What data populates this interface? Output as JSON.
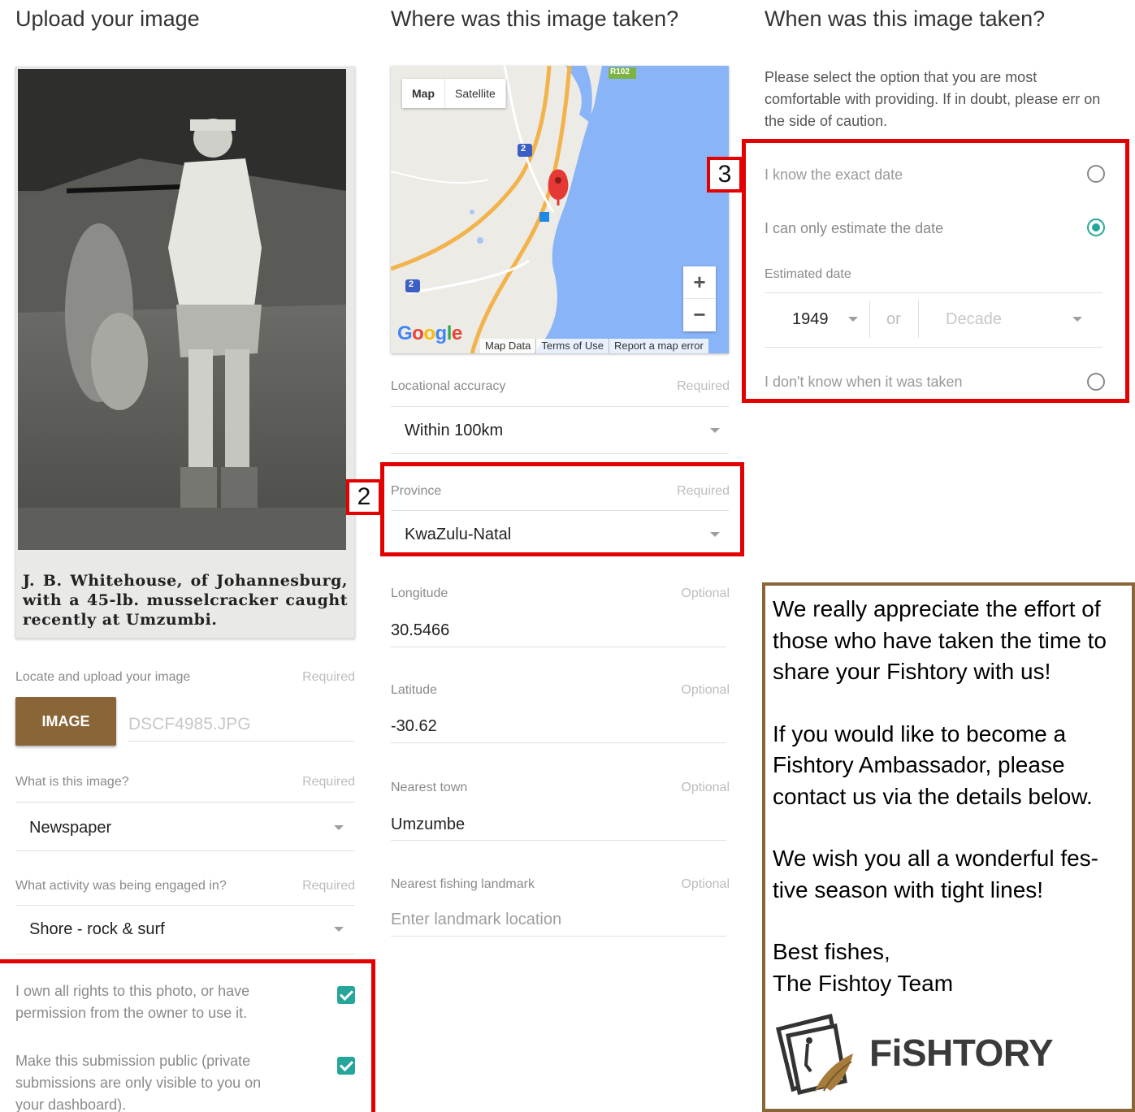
{
  "columns": {
    "upload": {
      "title": "Upload your image",
      "photo_caption": "J. B. Whitehouse, of Johannesburg, with a 45-lb. musselcracker caught recently at Umzumbi.",
      "upload_label": "Locate and upload your image",
      "upload_required": "Required",
      "image_button": "IMAGE",
      "file_name": "DSCF4985.JPG",
      "what_label": "What is this image?",
      "what_required": "Required",
      "what_value": "Newspaper",
      "activity_label": "What activity was being engaged in?",
      "activity_required": "Required",
      "activity_value": "Shore - rock & surf",
      "rights_text": "I own all rights to this photo, or have permission from the owner to use it.",
      "rights_checked": true,
      "public_text": "Make this submission public (private submissions are only visible to you on your dashboard).",
      "public_checked": true
    },
    "where": {
      "title": "Where was this image taken?",
      "map": {
        "type_map": "Map",
        "type_satellite": "Satellite",
        "zoom_in": "+",
        "zoom_out": "−",
        "google": "Google",
        "footer_data": "Map Data",
        "footer_terms": "Terms of Use",
        "footer_report": "Report a map error",
        "road_shield_1": "2",
        "road_shield_2": "2",
        "road_label": "R102"
      },
      "accuracy_label": "Locational accuracy",
      "accuracy_required": "Required",
      "accuracy_value": "Within 100km",
      "province_label": "Province",
      "province_required": "Required",
      "province_value": "KwaZulu-Natal",
      "longitude_label": "Longitude",
      "longitude_optional": "Optional",
      "longitude_value": "30.5466",
      "latitude_label": "Latitude",
      "latitude_optional": "Optional",
      "latitude_value": "-30.62",
      "town_label": "Nearest town",
      "town_optional": "Optional",
      "town_value": "Umzumbe",
      "landmark_label": "Nearest fishing landmark",
      "landmark_optional": "Optional",
      "landmark_placeholder": "Enter landmark location"
    },
    "when": {
      "title": "When was this image taken?",
      "intro": "Please select the option that you are most comfortable with providing. If in doubt, please err on the side of caution.",
      "exact_label": "I know the exact date",
      "estimate_label": "I can only estimate the date",
      "estimated_date_label": "Estimated date",
      "year_value": "1949",
      "or_text": "or",
      "decade_placeholder": "Decade",
      "unknown_label": "I don't know when it was taken",
      "selected_option": "estimate"
    }
  },
  "annotations": {
    "box2_number": "2",
    "box3_number": "3",
    "highlight_color": "#e30000"
  },
  "note": {
    "p1": "We really appreciate the effort of those who have taken the time to share your Fishtory with us!",
    "p2": "If you would like to become a Fishtory Ambassador, please contact us via the details below.",
    "p3": "We wish you all a wonderful fes-tive season with tight lines!",
    "sign1": "Best fishes,",
    "sign2": "The Fishtoy Team",
    "brand": "FiSHTORY",
    "border_color": "#8a6537"
  },
  "colors": {
    "accent_button": "#8a6537",
    "checkbox_teal": "#26a69a",
    "map_water": "#8ab4f8"
  }
}
